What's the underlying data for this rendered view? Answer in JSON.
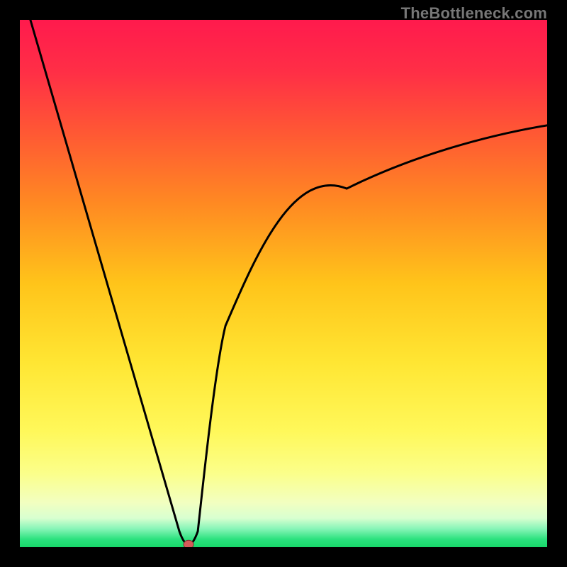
{
  "watermark": "TheBottleneck.com",
  "colors": {
    "frame": "#000000",
    "curve": "#000000",
    "marker_fill": "#d55a5a",
    "marker_stroke": "#7a2e2e",
    "gradient_stops": [
      {
        "offset": 0.0,
        "color": "#ff1a4d"
      },
      {
        "offset": 0.1,
        "color": "#ff2f46"
      },
      {
        "offset": 0.22,
        "color": "#ff5a33"
      },
      {
        "offset": 0.35,
        "color": "#ff8a22"
      },
      {
        "offset": 0.5,
        "color": "#ffc41a"
      },
      {
        "offset": 0.65,
        "color": "#ffe633"
      },
      {
        "offset": 0.78,
        "color": "#fff85a"
      },
      {
        "offset": 0.86,
        "color": "#fbff8a"
      },
      {
        "offset": 0.915,
        "color": "#f2ffc0"
      },
      {
        "offset": 0.945,
        "color": "#d8ffd0"
      },
      {
        "offset": 0.965,
        "color": "#88f5b8"
      },
      {
        "offset": 0.985,
        "color": "#2be27e"
      },
      {
        "offset": 1.0,
        "color": "#18d86a"
      }
    ]
  },
  "chart_data": {
    "type": "line",
    "title": "",
    "xlabel": "",
    "ylabel": "",
    "xlim": [
      0,
      100
    ],
    "ylim": [
      0,
      100
    ],
    "curve": {
      "left_top": {
        "x": 2,
        "y": 100
      },
      "minimum": {
        "x": 32,
        "y": 0.5
      },
      "right_end": {
        "x": 100,
        "y": 80
      },
      "right_control": {
        "x": 52,
        "y": 72
      },
      "notch_width": 3.5,
      "notch_height": 2.5
    },
    "marker": {
      "x": 32,
      "y": 0.5
    }
  }
}
